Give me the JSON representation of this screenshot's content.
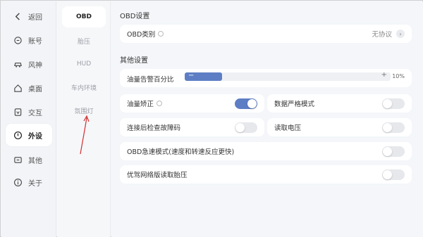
{
  "sidebar": {
    "items": [
      {
        "label": "返回",
        "icon": "back-icon"
      },
      {
        "label": "账号",
        "icon": "account-icon"
      },
      {
        "label": "风神",
        "icon": "car-icon"
      },
      {
        "label": "桌面",
        "icon": "home-icon"
      },
      {
        "label": "交互",
        "icon": "interaction-icon"
      },
      {
        "label": "外设",
        "icon": "peripheral-icon",
        "active": true
      },
      {
        "label": "其他",
        "icon": "other-icon"
      },
      {
        "label": "关于",
        "icon": "info-icon"
      }
    ]
  },
  "subnav": {
    "items": [
      {
        "label": "OBD",
        "active": true
      },
      {
        "label": "胎压"
      },
      {
        "label": "HUD"
      },
      {
        "label": "车内环境"
      },
      {
        "label": "氛围灯"
      }
    ]
  },
  "main": {
    "obd_section_title": "OBD设置",
    "obd_type": {
      "label": "OBD类别",
      "value": "无协议"
    },
    "other_section_title": "其他设置",
    "fuel_alert": {
      "label": "油量告警百分比",
      "value_text": "10%",
      "fraction": 0.18
    },
    "settings": {
      "fuel_correction": {
        "label": "油量矫正",
        "on": true
      },
      "strict_data": {
        "label": "数据严格模式",
        "on": false
      },
      "check_fault": {
        "label": "连接后检查故障码",
        "on": false
      },
      "read_voltage": {
        "label": "读取电压",
        "on": false
      },
      "obd_fast": {
        "label": "OBD急速模式(速度和转速反应更快)",
        "on": false
      },
      "read_tire": {
        "label": "优驾网络版读取胎压",
        "on": false
      }
    }
  },
  "colors": {
    "accent": "#5d7ec4",
    "annotation": "#d32f2f"
  }
}
